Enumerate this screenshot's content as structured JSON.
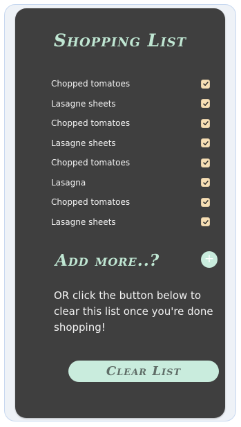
{
  "title": "Shopping List",
  "items": [
    {
      "label": "Chopped tomatoes",
      "checked": true
    },
    {
      "label": "Lasagne sheets",
      "checked": true
    },
    {
      "label": "Chopped tomatoes",
      "checked": true
    },
    {
      "label": "Lasagne sheets",
      "checked": true
    },
    {
      "label": "Chopped tomatoes",
      "checked": true
    },
    {
      "label": "Lasagna",
      "checked": true
    },
    {
      "label": "Chopped tomatoes",
      "checked": true
    },
    {
      "label": "Lasagne sheets",
      "checked": true
    }
  ],
  "add_more": {
    "label": "Add more..?",
    "button_symbol": "+",
    "icon": "plus-icon"
  },
  "hint_text": "OR click the button below to clear this list once you're done shopping!",
  "clear_button_label": "Clear List",
  "colors": {
    "background_panel": "#3f3f3f",
    "accent": "#bfe6d2",
    "button_fill": "#c9ecdd",
    "checkbox_fill": "#f7dfb5",
    "check_mark": "#2e2e2e"
  }
}
